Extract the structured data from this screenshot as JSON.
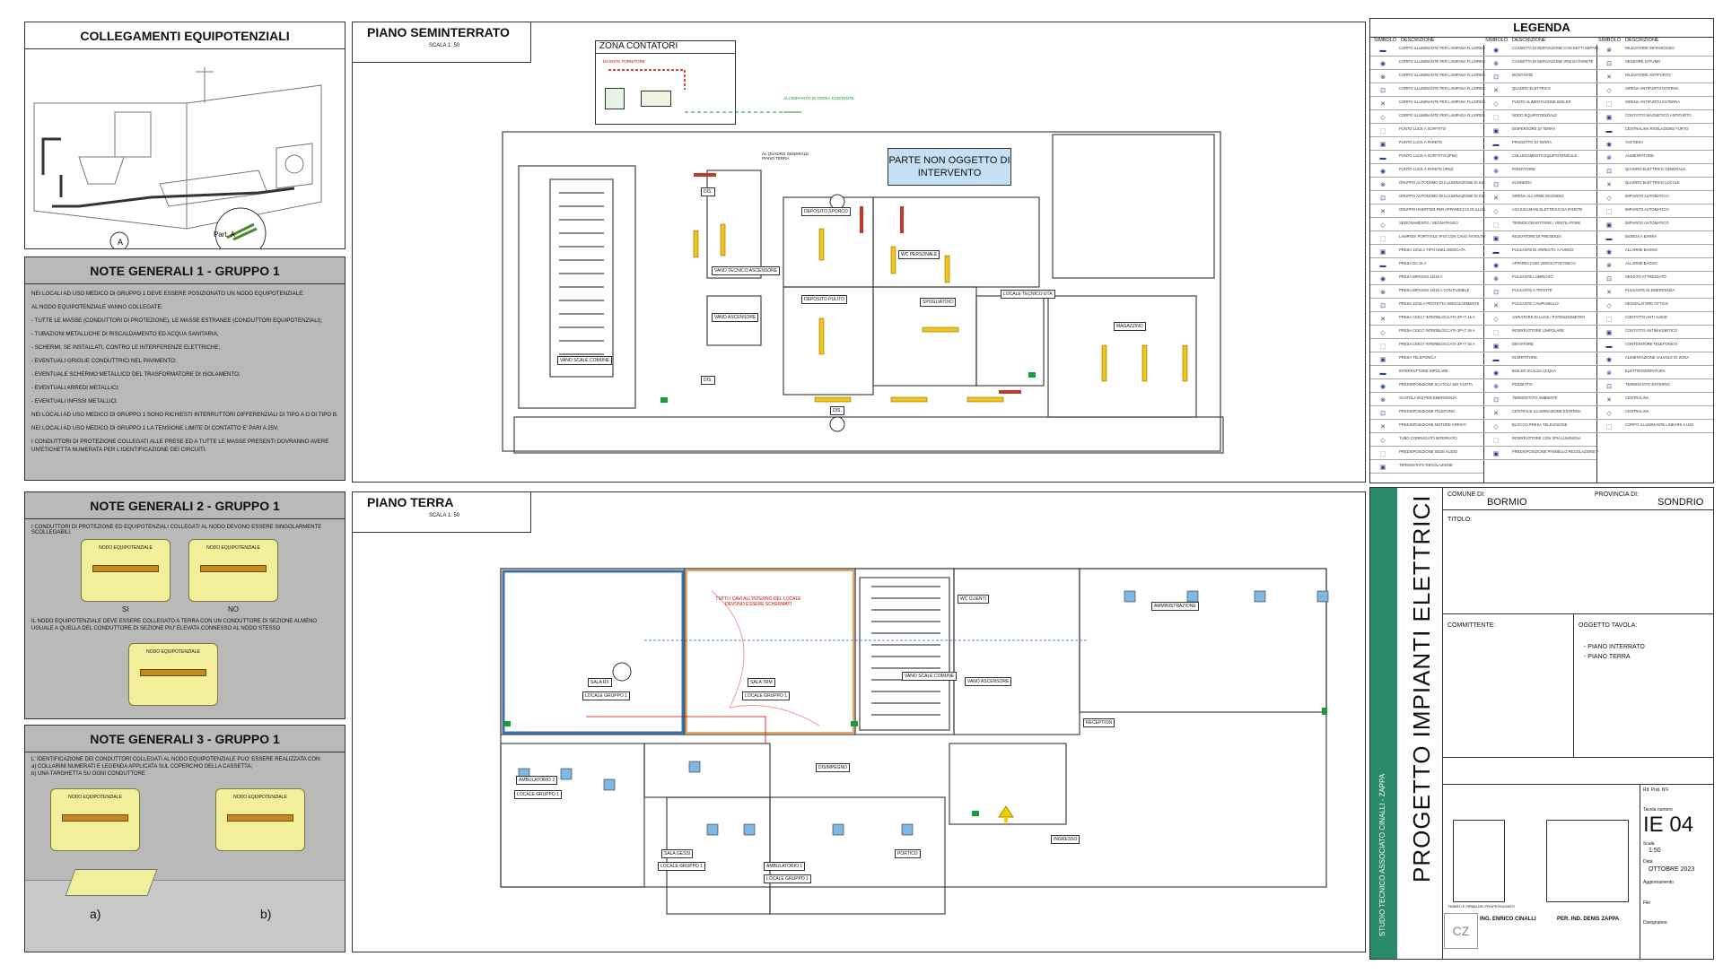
{
  "equip": {
    "title": "COLLEGAMENTI EQUIPOTENZIALI",
    "part_label": "Part. A",
    "callout": "A"
  },
  "note1": {
    "title": "NOTE GENERALI 1 - GRUPPO 1",
    "lines": [
      "NEI LOCALI AD USO MEDICO DI GRUPPO  1  DEVE ESSERE POSIZIONATO UN NODO EQUIPOTENZIALE.",
      "AL NODO EQUIPOTENZIALE VANNO COLLEGATE:",
      "- TUTTE LE MASSE (CONDUTTORI DI PROTEZIONE), LE MASSE ESTRANEE (CONDUTTORI EQUIPOTENZIALI);",
      "- TUBAZIONI METALLICHE DI RISCALDAMENTO ED ACQUA SANITARIA;",
      "- SCHERMI, SE INSTALLATI, CONTRO LE INTERFERENZE ELETTRICHE;",
      "- EVENTUALI GRIGLIE CONDUTTRICI NEL PAVIMENTO;",
      "- EVENTUALE SCHERMO METALLICO DEL TRASFORMATORE DI ISOLAMENTO;",
      "- EVENTUALI ARREDI METALLICI;",
      "- EVENTUALI INFISSI METALLICI.",
      "NEI LOCALI AD USO MEDICO DI GRUPPO 1 SONO RICHIESTI INTERRUTTORI DIFFERENZIALI DI TIPO A O DI TIPO B.",
      "NEI LOCALI AD USO MEDICO DI GRUPPO 1 LA TENSIONE LIMITE DI CONTATTO E' PARI A 25V.",
      "I CONDUTTORI DI PROTEZIONE COLLEGATI ALLE PRESE ED A TUTTE LE MASSE PRESENTI DOVRANNO AVERE UN'ETICHETTA NUMERATA PER L'IDENTIFICAZIONE DEI CIRCUITI."
    ]
  },
  "note2": {
    "title": "NOTE GENERALI 2 - GRUPPO 1",
    "text1": "I CONDUTTORI DI PROTEZIONE ED EQUIPOTENZIALI COLLEGATI AL NODO DEVONO ESSERE SINGOLARMENTE SCOLLEGABILI.",
    "yes": "SI",
    "no": "NO",
    "node_label": "NODO EQUIPOTENZIALE",
    "text2": "IL NODO EQUIPOTENZIALE DEVE ESSERE COLLEGATO A TERRA CON UN CONDUTTORE DI SEZIONE ALMENO UGUALE A QUELLA DEL CONDUTTORE DI SEZIONE PIU' ELEVATA CONNESSO AL NODO STESSO"
  },
  "note3": {
    "title": "NOTE GENERALI 3 - GRUPPO 1",
    "text1": "L' IDENTIFICAZIONE DEI CONDUTTORI COLLEGATI AL NODO EQUIPOTENZIALE PUO' ESSERE REALIZZATA CON:",
    "text2": "a) COLLARINI NUMERATI E LEGENDA APPLICATA SUL COPERCHIO DELLA CASSETTA;",
    "text3": "b) UNA TARGHETTA SU OGNI CONDUTTORE",
    "cap_a": "a)",
    "cap_b": "b)"
  },
  "semint": {
    "title": "PIANO SEMINTERRATO",
    "scale": "SCALA 1: 50",
    "zona": "ZONA CONTATORI",
    "non_oggetto": "PARTE NON OGGETTO DI INTERVENTO",
    "da_ente": "DA ENTE FORNITORE",
    "impianto_terra": "ALL'IMPIANTO DI TERRA ESISTENTE",
    "quadro": "AL QUADRO GENERALE PIANO TERRA",
    "rooms": [
      "DEPOSITO SPORCO",
      "DEPOSITO PULITO",
      "VANO TECNICO ASCENSORE",
      "VANO ASCENSORE",
      "VANO SCALE COMUNE",
      "WC PERSONALE",
      "SPOGLIATOIO",
      "LOCALE TECNICO UTA",
      "MAGAZZINO",
      "DIS.",
      "DIS.",
      "DIS."
    ]
  },
  "terra": {
    "title": "PIANO TERRA",
    "scale": "SCALA 1: 50",
    "rooms": [
      "SALA RX",
      "LOCALE GRUPPO 1",
      "SALA TRM",
      "LOCALE GRUPPO 1",
      "WC CLIENTI",
      "VANO SCALE COMUNE",
      "VANO ASCENSORE",
      "RECEPTION",
      "AMBULATORIO 2",
      "LOCALE GRUPPO 1",
      "DISIMPEGNO",
      "SALA GESSI",
      "LOCALE GRUPPO 1",
      "AMBULATORIO 1",
      "LOCALE GRUPPO 1",
      "PORTICO",
      "INGRESSO",
      "AMMINISTRAZIONE"
    ],
    "warning": "TUTTI I CAVI ALL'INTERNO DEL LOCALE DEVONO ESSERE SCHERMATI"
  },
  "legenda": {
    "title": "LEGENDA",
    "col_sym": "SIMBOLO",
    "col_desc": "DESCRIZIONE",
    "col1": [
      "CORPO ILLUMINANTE PER LAMPADA FLUORESCENTE LINEARE",
      "CORPO ILLUMINANTE PER LAMPADA FLUORESCENTE LINEARE",
      "CORPO ILLUMINANTE PER LAMPADA FLUORESCENTE LINEARE",
      "CORPO ILLUMINANTE PER LAMPADA FLUORESCENTE LINEARE",
      "CORPO ILLUMINANTE PER LAMPADA FLUORESCENTE LINEARE",
      "CORPO ILLUMINANTE PER LAMPADA FLUORESCENTE LINEARE",
      "PUNTO LUCE A SOFFITTO",
      "PUNTO LUCE A PARETE",
      "PUNTO LUCE A SOFFITTO (IP54)",
      "PUNTO LUCE A PARETE (IP54)",
      "GRUPPO AUTONOMO DI ILLUMINAZIONE DI SICUREZZA",
      "GRUPPO AUTONOMO DI ILLUMINAZIONE DI SICUREZZA (IP54)",
      "GRUPPO INVERTER PER APPARECCHI DI ILLUMINAZIONE",
      "SEZIONAMENTO / SEGNAPASSO",
      "LAMPADA PORTATILE IP44 CON CAVO AVVOLTO SU ARROTOLATORE",
      "PRESA 10/16 A TIPO UNEL DEDICATA",
      "PRESA DA 16 A",
      "PRESA BIPASSO 10/16 A",
      "PRESA BIPASSO 10/16 A CON FUSIBILE",
      "PRESA 10/16 A PROTETTA SINGOLARMENTE",
      "PRESA CEE17 INTERBLOCCATA 2P+T 16 A",
      "PRESA CEE17 INTERBLOCCATA 3P+T 16 A",
      "PRESA CEE17 INTERBLOCCATA 3P+T 32 A",
      "PRESA TELEFONICA",
      "INTERRUTTORE BIPOLARE",
      "PREDISPOSIZIONE SCATOLA 503 VUOTA",
      "SCATOLA 503 PER EMERGENZA",
      "PREDISPOSIZIONE TELEFONO",
      "PREDISPOSIZIONE MOTORE ARRIVO",
      "TUBO CORRUGATO INTERRATO",
      "PREDISPOSIZIONE SEDE AUDIO",
      "TERMOSTATO REGOLAZIONE"
    ],
    "col2": [
      "CASSETTA DI DERIVAZIONE CON SETTI SEPARATORI",
      "CASSETTA DI DERIVAZIONE IP55 DA PARETE",
      "MONTANTE",
      "QUADRO ELETTRICO",
      "PUNTO ALIMENTAZIONE BOILER",
      "NODO EQUIPOTENZIALE",
      "DISPERSORE DI TERRA",
      "PROGETTO DI TERRA",
      "COLLEGAMENTO EQUIPOTENZIALE",
      "RONZATORE",
      "SUONERIA",
      "SIRENA ALLARME INCENDIO",
      "ASCIUGAMANI ELETTRICO DA PARETE",
      "TERMOCONVETTORE / VENTILATORE",
      "RILEVATORE DI PRESENZA",
      "PULSANTE DI ARRESTO A FUNGO",
      "APPARECCHIO VIDEOCITOFONICO",
      "PULSANTE LUMINOSO",
      "PULSANTE A TIRANTE",
      "PULSANTE CAMPANELLO",
      "VARIATORE DI LUCE / POTENZIOMETRO",
      "INTERRUTTORE UNIPOLARE",
      "DEVIATORE",
      "INVERTITORE",
      "BOILER SCALDA ACQUA",
      "POZZETTO",
      "TERMOSTATO AMBIENTE",
      "CENTRALE ILLUMINAZIONE ESTERNA",
      "BLOCCO PRESA TELEVISIONE",
      "INTERRUTTORE CON SPIA LUMINOSA",
      "PREDISPOSIZIONE PANNELLO REGOLAZIONE AUDIO"
    ],
    "col3": [
      "RILEVATORE INFRAROSSO",
      "SENSORE DI FUMO",
      "RILEVATORE ANTIFURTO",
      "SIRENA ANTIFURTO INTERNA",
      "SIRENA ANTIFURTO ESTERNA",
      "CONTATTO MAGNETICO ANTIFURTO",
      "CENTRALINA RIVELAZIONE FURTO",
      "TASTIERA",
      "ALIMENTATORE",
      "QUADRO ELETTRICO GENERALE",
      "QUADRO ELETTRICO LOCALE",
      "IMPIANTO AUTOMATICO",
      "IMPIANTO AUTOMATICO",
      "IMPIANTO AUTOMATICO",
      "BIOBOX A BARRA",
      "ALLARME BAGNO",
      "ALLARME BAGNO",
      "SEDIATO ATTREZZATO",
      "PULSANTE DI EMERGENZA",
      "SEGNALATORE OTTICO",
      "CONTATTO ANTI AUDIO",
      "CONTATTO ANTIMAGNETICO",
      "CONTENITORE TELEFONICO",
      "ALIMENTAZIONE VALVOLE DI ZONA",
      "ELETTROSERRATURA",
      "TERMOSTATO ESTERNO",
      "CENTRALINA",
      "CENTRALINA",
      "CORPO ILLUMINANTE LINEARE A LED"
    ]
  },
  "title_block": {
    "comune_label": "COMUNE DI:",
    "comune": "BORMIO",
    "provincia_label": "PROVINCIA DI:",
    "provincia": "SONDRIO",
    "titolo_label": "TITOLO:",
    "committente_label": "COMMITTENTE:",
    "oggetto_label": "OGGETTO TAVOLA:",
    "oggetto_1": "- PIANO INTERRATO",
    "oggetto_2": "- PIANO TERRA",
    "progetto": "PROGETTO IMPIANTI ELETTRICI",
    "studio": "STUDIO TECNICO ASSOCIATO CINALLI - ZAPPA",
    "tavola_label": "Tavola numero",
    "tavola": "IE 04",
    "scala_label": "Scala",
    "scala": "1:50",
    "data_label": "Data",
    "data": "OTTOBRE 2023",
    "aggiornamento_label": "Aggiornamento",
    "file_label": "File",
    "disegnatore_label": "Disegnatore",
    "rif_label": "Rif. Prat. N'F.",
    "ing": "ING. ENRICO CINALLI",
    "per": "PER. IND. DENIS ZAPPA",
    "timbro": "TIMBRO E FIRMA DEI PROFESSIONISTI"
  }
}
